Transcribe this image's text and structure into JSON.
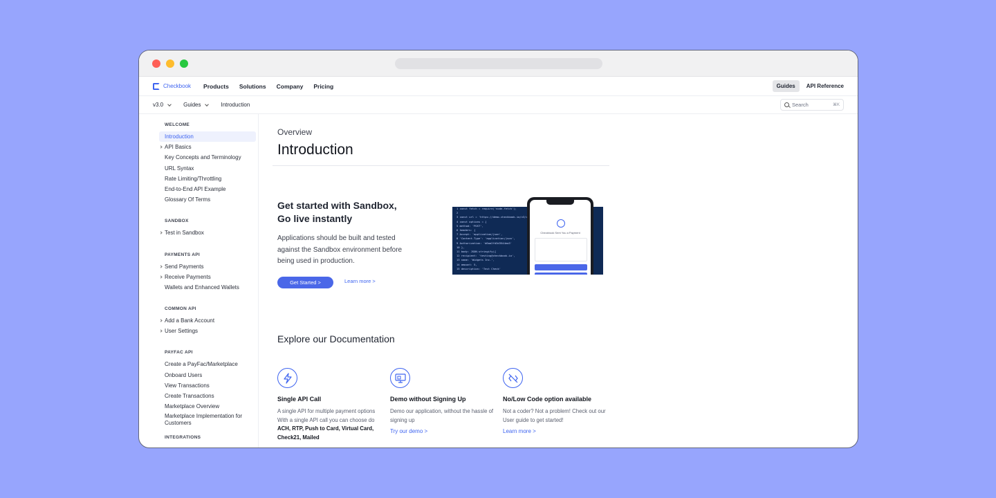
{
  "brand": {
    "name": "Checkbook"
  },
  "topnav": {
    "items": [
      "Products",
      "Solutions",
      "Company",
      "Pricing"
    ],
    "guides": "Guides",
    "api_reference": "API Reference"
  },
  "subnav": {
    "version": "v3.0",
    "section": "Guides",
    "page": "Introduction",
    "search_placeholder": "Search",
    "search_shortcut": "⌘K"
  },
  "sidebar": {
    "welcome": {
      "title": "WELCOME",
      "items": [
        "Introduction",
        "API Basics",
        "Key Concepts and Terminology",
        "URL Syntax",
        "Rate Limiting/Throttling",
        "End-to-End API Example",
        "Glossary Of Terms"
      ]
    },
    "sandbox": {
      "title": "SANDBOX",
      "items": [
        "Test in Sandbox"
      ]
    },
    "payments": {
      "title": "PAYMENTS API",
      "items": [
        "Send Payments",
        "Receive Payments",
        "Wallets and Enhanced Wallets"
      ]
    },
    "common": {
      "title": "COMMON API",
      "items": [
        "Add a Bank Account",
        "User Settings"
      ]
    },
    "payfac": {
      "title": "PAYFAC API",
      "items": [
        "Create a PayFac/Marketplace",
        "Onboard Users",
        "View Transactions",
        "Create Transactions",
        "Marketplace Overview",
        "Marketplace Implementation for Customers"
      ]
    },
    "integrations": {
      "title": "INTEGRATIONS"
    }
  },
  "main": {
    "breadcrumb": "Overview",
    "title": "Introduction",
    "hero": {
      "heading": "Get started with Sandbox, Go live instantly",
      "body": "Applications should be built and tested against the Sandbox environment before being used in production.",
      "cta": "Get Started >",
      "learn_more": "Learn more >",
      "phone_text": "Checkbook Sent You a Payment"
    },
    "explore_title": "Explore our Documentation",
    "features": [
      {
        "icon": "lightning-icon",
        "title": "Single API Call",
        "body_prefix": "A single API for multiple payment options With a single API call you can choose do ",
        "body_bold": "ACH, RTP, Push to Card, Virtual Card, Check21, Mailed"
      },
      {
        "icon": "monitor-icon",
        "title": "Demo without Signing Up",
        "body": "Demo our application, without the hassle of signing up",
        "link": "Try our demo >"
      },
      {
        "icon": "no-code-icon",
        "title": "No/Low Code option available",
        "body": "Not a coder? Not a problem! Check out our User guide to get started!",
        "link": "Learn more >"
      }
    ]
  },
  "colors": {
    "accent": "#3d63f0",
    "background": "#97a5fd",
    "button": "#4a67e8"
  }
}
